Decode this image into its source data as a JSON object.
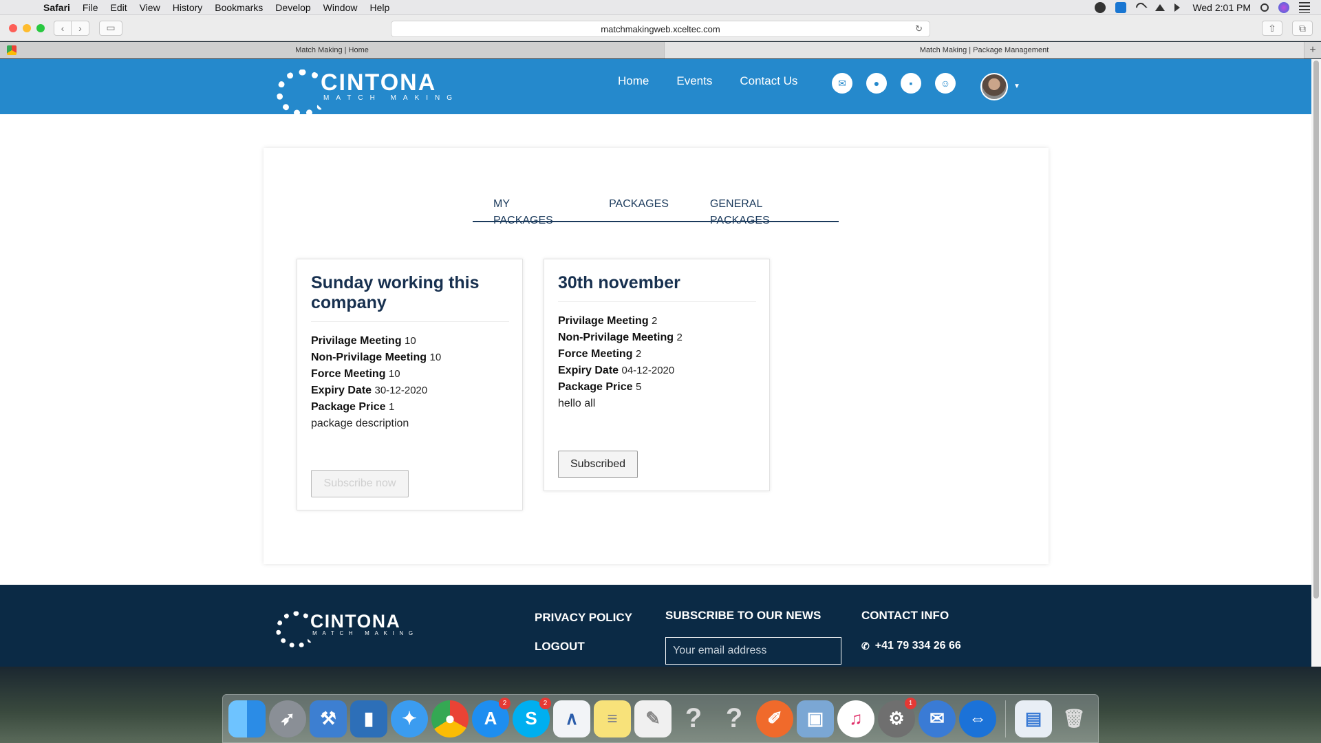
{
  "menubar": {
    "app": "Safari",
    "items": [
      "File",
      "Edit",
      "View",
      "History",
      "Bookmarks",
      "Develop",
      "Window",
      "Help"
    ],
    "clock": "Wed 2:01 PM"
  },
  "browser": {
    "url": "matchmakingweb.xceltec.com",
    "tabs": [
      "Match Making | Home",
      "Match Making | Package Management"
    ]
  },
  "header": {
    "logo_name": "CINTONA",
    "logo_tagline": "MATCH MAKING",
    "nav": [
      "Home",
      "Events",
      "Contact Us"
    ]
  },
  "package_tabs": [
    "MY PACKAGES",
    "PACKAGES",
    "GENERAL PACKAGES"
  ],
  "packages": [
    {
      "title": "Sunday working this company",
      "rows": [
        {
          "label": "Privilage Meeting",
          "value": "10"
        },
        {
          "label": "Non-Privilage Meeting",
          "value": "10"
        },
        {
          "label": "Force Meeting",
          "value": "10"
        },
        {
          "label": "Expiry Date",
          "value": "30-12-2020"
        },
        {
          "label": "Package Price",
          "value": "1"
        }
      ],
      "description": "package description",
      "button": "Subscribe now"
    },
    {
      "title": "30th november",
      "rows": [
        {
          "label": "Privilage Meeting",
          "value": "2"
        },
        {
          "label": "Non-Privilage Meeting",
          "value": "2"
        },
        {
          "label": "Force Meeting",
          "value": "2"
        },
        {
          "label": "Expiry Date",
          "value": "04-12-2020"
        },
        {
          "label": "Package Price",
          "value": "5"
        }
      ],
      "description": "hello all",
      "button": "Subscribed"
    }
  ],
  "footer": {
    "logo_name": "CINTONA",
    "logo_tagline": "MATCH MAKING",
    "privacy": "PRIVACY POLICY",
    "logout": "LOGOUT",
    "subscribe_heading": "SUBSCRIBE TO OUR NEWS",
    "email_placeholder": "Your email address",
    "contact_heading": "CONTACT INFO",
    "phone": "+41 79 334 26 66"
  },
  "dock": {
    "badges": {
      "app_store": "2",
      "skype": "2",
      "system_prefs": "1"
    }
  },
  "colors": {
    "header_bg": "#2589cc",
    "footer_bg": "#0b2a45",
    "title_text": "#17304f"
  }
}
